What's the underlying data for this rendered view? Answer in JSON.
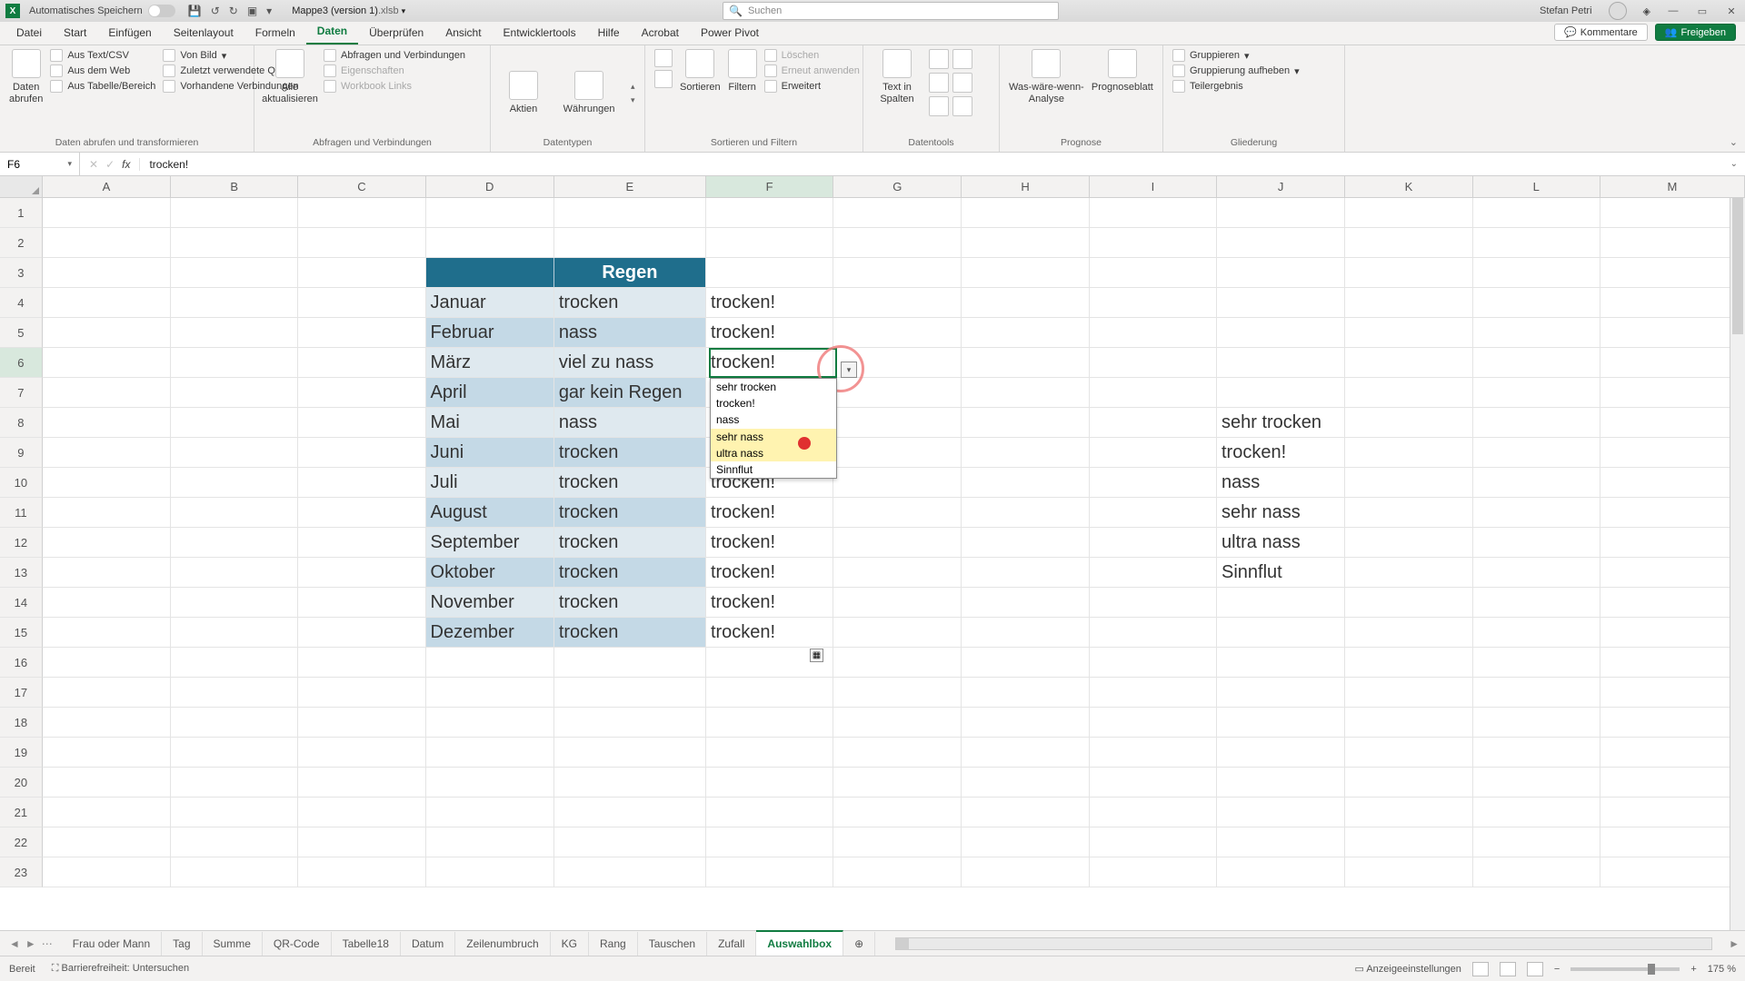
{
  "title": {
    "autosave": "Automatisches Speichern",
    "docname": "Mappe3 (version 1)",
    "docext": ".xlsb",
    "search_placeholder": "Suchen",
    "username": "Stefan Petri"
  },
  "menu": {
    "tabs": [
      "Datei",
      "Start",
      "Einfügen",
      "Seitenlayout",
      "Formeln",
      "Daten",
      "Überprüfen",
      "Ansicht",
      "Entwicklertools",
      "Hilfe",
      "Acrobat",
      "Power Pivot"
    ],
    "active": "Daten",
    "comments": "Kommentare",
    "share": "Freigeben"
  },
  "ribbon": {
    "g1": {
      "big": "Daten\nabrufen",
      "items": [
        "Aus Text/CSV",
        "Von Bild",
        "Aus dem Web",
        "Zuletzt verwendete Quellen",
        "Aus Tabelle/Bereich",
        "Vorhandene Verbindungen"
      ],
      "label": "Daten abrufen und transformieren"
    },
    "g2": {
      "big": "Alle\naktualisieren",
      "items": [
        "Abfragen und Verbindungen",
        "Eigenschaften",
        "Workbook Links"
      ],
      "label": "Abfragen und Verbindungen"
    },
    "g3": {
      "a": "Aktien",
      "b": "Währungen",
      "label": "Datentypen"
    },
    "g4": {
      "sort": "Sortieren",
      "filter": "Filtern",
      "items": [
        "Löschen",
        "Erneut anwenden",
        "Erweitert"
      ],
      "label": "Sortieren und Filtern"
    },
    "g5": {
      "big": "Text in\nSpalten",
      "label": "Datentools"
    },
    "g6": {
      "a": "Was-wäre-wenn-\nAnalyse",
      "b": "Prognoseblatt",
      "label": "Prognose"
    },
    "g7": {
      "items": [
        "Gruppieren",
        "Gruppierung aufheben",
        "Teilergebnis"
      ],
      "label": "Gliederung"
    }
  },
  "formula": {
    "cellref": "F6",
    "content": "trocken!"
  },
  "columns": [
    "A",
    "B",
    "C",
    "D",
    "E",
    "F",
    "G",
    "H",
    "I",
    "J",
    "K",
    "L",
    "M"
  ],
  "rownums": [
    1,
    2,
    3,
    4,
    5,
    6,
    7,
    8,
    9,
    10,
    11,
    12,
    13,
    14,
    15,
    16,
    17,
    18,
    19,
    20,
    21,
    22,
    23
  ],
  "table": {
    "header_e": "Regen",
    "rows": [
      {
        "d": "Januar",
        "e": "trocken",
        "f": "trocken!"
      },
      {
        "d": "Februar",
        "e": "nass",
        "f": "trocken!"
      },
      {
        "d": "März",
        "e": "viel zu nass",
        "f": "trocken!"
      },
      {
        "d": "April",
        "e": "gar kein Regen",
        "f": ""
      },
      {
        "d": "Mai",
        "e": "nass",
        "f": ""
      },
      {
        "d": "Juni",
        "e": "trocken",
        "f": ""
      },
      {
        "d": "Juli",
        "e": "trocken",
        "f": "trocken!"
      },
      {
        "d": "August",
        "e": "trocken",
        "f": "trocken!"
      },
      {
        "d": "September",
        "e": "trocken",
        "f": "trocken!"
      },
      {
        "d": "Oktober",
        "e": "trocken",
        "f": "trocken!"
      },
      {
        "d": "November",
        "e": "trocken",
        "f": "trocken!"
      },
      {
        "d": "Dezember",
        "e": "trocken",
        "f": "trocken!"
      }
    ]
  },
  "dropdown": {
    "opts": [
      "sehr trocken",
      "trocken!",
      "nass",
      "sehr nass",
      "ultra nass",
      "Sinnflut"
    ],
    "hl_index": 4
  },
  "sidevalues": [
    "sehr trocken",
    "trocken!",
    "nass",
    "sehr nass",
    "ultra nass",
    "Sinnflut"
  ],
  "sheets": [
    "Frau oder Mann",
    "Tag",
    "Summe",
    "QR-Code",
    "Tabelle18",
    "Datum",
    "Zeilenumbruch",
    "KG",
    "Rang",
    "Tauschen",
    "Zufall",
    "Auswahlbox"
  ],
  "sheet_active": "Auswahlbox",
  "status": {
    "mode": "Bereit",
    "access": "Barrierefreiheit: Untersuchen",
    "display": "Anzeigeeinstellungen",
    "zoom": "175 %"
  }
}
